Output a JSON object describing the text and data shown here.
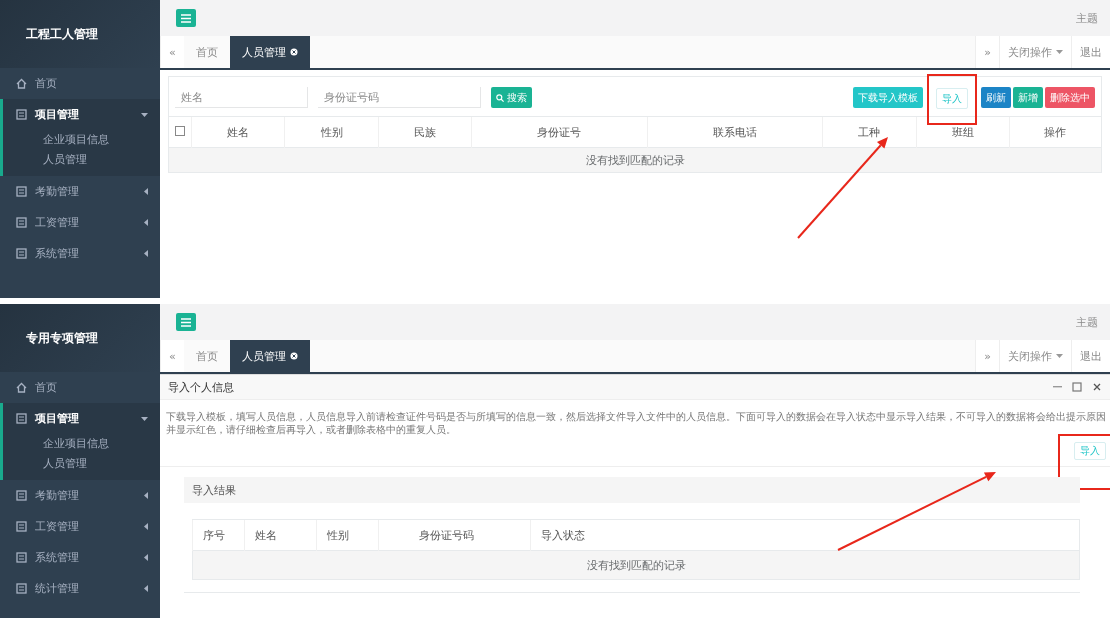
{
  "screens": [
    {
      "sidebar": {
        "logo": "工程工人管理",
        "items": [
          {
            "label": "首页",
            "selected": false
          },
          {
            "label": "项目管理",
            "selected": true,
            "expanded": true,
            "children": [
              {
                "label": "企业项目信息",
                "selected": false
              },
              {
                "label": "人员管理",
                "selected": false
              }
            ]
          },
          {
            "label": "考勤管理",
            "selected": false,
            "expanded": false
          },
          {
            "label": "工资管理",
            "selected": false,
            "expanded": false
          },
          {
            "label": "系统管理",
            "selected": false,
            "expanded": false
          }
        ]
      },
      "topbar": {
        "theme": "主题"
      },
      "tabs": {
        "prev": "«",
        "items": [
          {
            "label": "首页",
            "selected": false
          },
          {
            "label": "人员管理",
            "selected": true
          }
        ],
        "next": "»",
        "close_menu": "关闭操作",
        "logout": "退出"
      },
      "content": {
        "kind": "list",
        "select_all_checked": false,
        "search_fields": [
          {
            "placeholder": "姓名"
          },
          {
            "placeholder": "身份证号码"
          }
        ],
        "search_button": "搜索",
        "actions": [
          {
            "label": "下载导入模板",
            "kind": "info",
            "highlighted": false
          },
          {
            "label": "导入",
            "kind": "plain",
            "highlighted": true
          },
          {
            "label": "刷新",
            "kind": "primary",
            "highlighted": false
          },
          {
            "label": "新增",
            "kind": "success",
            "highlighted": false
          },
          {
            "label": "删除选中",
            "kind": "danger",
            "highlighted": false
          }
        ],
        "columns": [
          "姓名",
          "性别",
          "民族",
          "身份证号",
          "联系电话",
          "工种",
          "班组",
          "操作"
        ],
        "empty": "没有找到匹配的记录"
      }
    },
    {
      "sidebar": {
        "logo": "专用专项管理",
        "items": [
          {
            "label": "首页",
            "selected": false
          },
          {
            "label": "项目管理",
            "selected": true,
            "expanded": true,
            "children": [
              {
                "label": "企业项目信息",
                "selected": false
              },
              {
                "label": "人员管理",
                "selected": false
              }
            ]
          },
          {
            "label": "考勤管理",
            "selected": false,
            "expanded": false
          },
          {
            "label": "工资管理",
            "selected": false,
            "expanded": false
          },
          {
            "label": "系统管理",
            "selected": false,
            "expanded": false
          },
          {
            "label": "统计管理",
            "selected": false,
            "expanded": false
          }
        ]
      },
      "topbar": {
        "theme": "主题"
      },
      "tabs": {
        "prev": "«",
        "items": [
          {
            "label": "首页",
            "selected": false
          },
          {
            "label": "人员管理",
            "selected": true
          }
        ],
        "next": "»",
        "close_menu": "关闭操作",
        "logout": "退出"
      },
      "content": {
        "kind": "import",
        "title": "导入个人信息",
        "description": "下载导入模板，填写人员信息，人员信息导入前请检查证件号码是否与所填写的信息一致，然后选择文件导入文件中的人员信息。下面可导入的数据会在导入状态中显示导入结果，不可导入的数据将会给出提示原因并显示红色，请仔细检查后再导入，或者删除表格中的重复人员。",
        "import_button": {
          "label": "导入",
          "highlighted": true
        },
        "result": {
          "title": "导入结果",
          "columns": [
            "序号",
            "姓名",
            "性别",
            "身份证号码",
            "导入状态"
          ],
          "empty": "没有找到匹配的记录"
        }
      }
    }
  ]
}
